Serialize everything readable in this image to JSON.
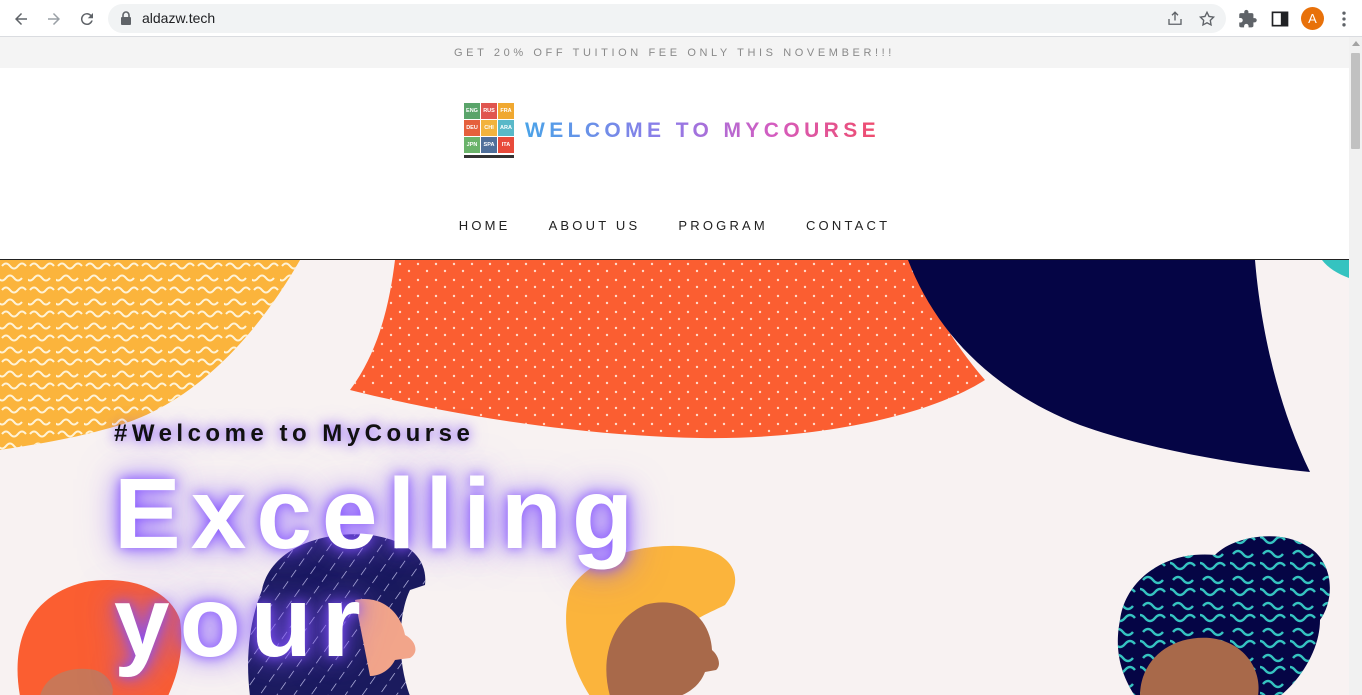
{
  "browser": {
    "url": "aldazw.tech",
    "avatar_letter": "A",
    "icons": [
      "back-icon",
      "forward-icon",
      "reload-icon",
      "lock-icon",
      "share-icon",
      "star-icon",
      "extensions-icon",
      "side-panel-icon",
      "menu-kebab-icon"
    ]
  },
  "promo": {
    "text": "GET 20% OFF TUITION FEE ONLY THIS NOVEMBER!!!"
  },
  "header": {
    "title": "WELCOME TO MYCOURSE",
    "logo_tiles": [
      {
        "label": "ENG",
        "color": "#5aa46a"
      },
      {
        "label": "RUS",
        "color": "#e0554f"
      },
      {
        "label": "FRA",
        "color": "#f0a830"
      },
      {
        "label": "DEU",
        "color": "#e5603c"
      },
      {
        "label": "CHI",
        "color": "#f2b33d"
      },
      {
        "label": "ARA",
        "color": "#59b8c8"
      },
      {
        "label": "JPN",
        "color": "#6ab36a"
      },
      {
        "label": "SPA",
        "color": "#4f6f9a"
      },
      {
        "label": "ITA",
        "color": "#e84a3a"
      }
    ]
  },
  "nav": {
    "items": [
      "HOME",
      "ABOUT US",
      "PROGRAM",
      "CONTACT"
    ]
  },
  "hero": {
    "tagline": "#Welcome to MyCourse",
    "headline": "Excelling your"
  },
  "colors": {
    "hero_bg": "#f8f2f2",
    "orange": "#fb5e31",
    "navy": "#050545",
    "yellow": "#fbb43c",
    "skin": "#a8694a",
    "teal": "#35c3c0"
  }
}
